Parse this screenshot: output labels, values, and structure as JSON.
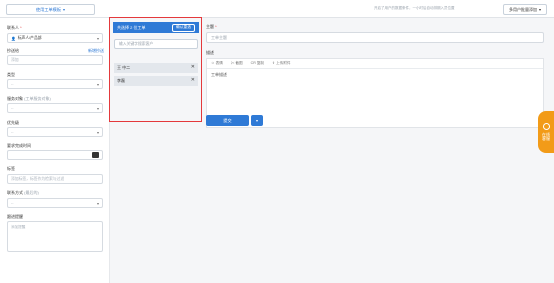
{
  "topbar": {
    "template_button": "使用工单模板",
    "note": "开启了用户的数据条件，一小时后自动排期入员位置",
    "right_button": "多用户批量添加"
  },
  "left": {
    "requester_label": "联系人",
    "requester_value": "标声人/产品部",
    "cc_label": "抄送给",
    "cc_link": "新增抄送",
    "cc_placeholder": "添加",
    "type_label": "类型",
    "type_value": "--",
    "assignee_label": "服务对象",
    "assignee_note": "(工单服务对象)",
    "assignee_value": "--",
    "priority_label": "优先级",
    "priority_value": "--",
    "deadline_label": "要求完成时间",
    "tags_label": "标签",
    "tags_placeholder": "添加标签，标签作为检索与过滤",
    "contact_label": "联系方式",
    "contact_note": "(最后的)",
    "contact_value": "--",
    "remark_label": "跟进提醒",
    "remark_placeholder": "添加提醒"
  },
  "popup": {
    "title": "共选择 2 位工单",
    "confirm": "确认重选",
    "search_placeholder": "输入关键字搜索客户",
    "items": [
      "王 中二",
      "李磊"
    ]
  },
  "main": {
    "subject_label": "主题",
    "subject_placeholder": "工单主题",
    "desc_label": "描述",
    "toolbar": [
      "表情",
      "截图",
      "CR 复制",
      "上传附件"
    ],
    "editor_text": "工单描述",
    "submit": "提交"
  },
  "float_widget": {
    "label": "在线客服"
  },
  "colors": {
    "accent": "#2f7ad6",
    "highlight": "#e4393c",
    "widget": "#f29b18"
  }
}
